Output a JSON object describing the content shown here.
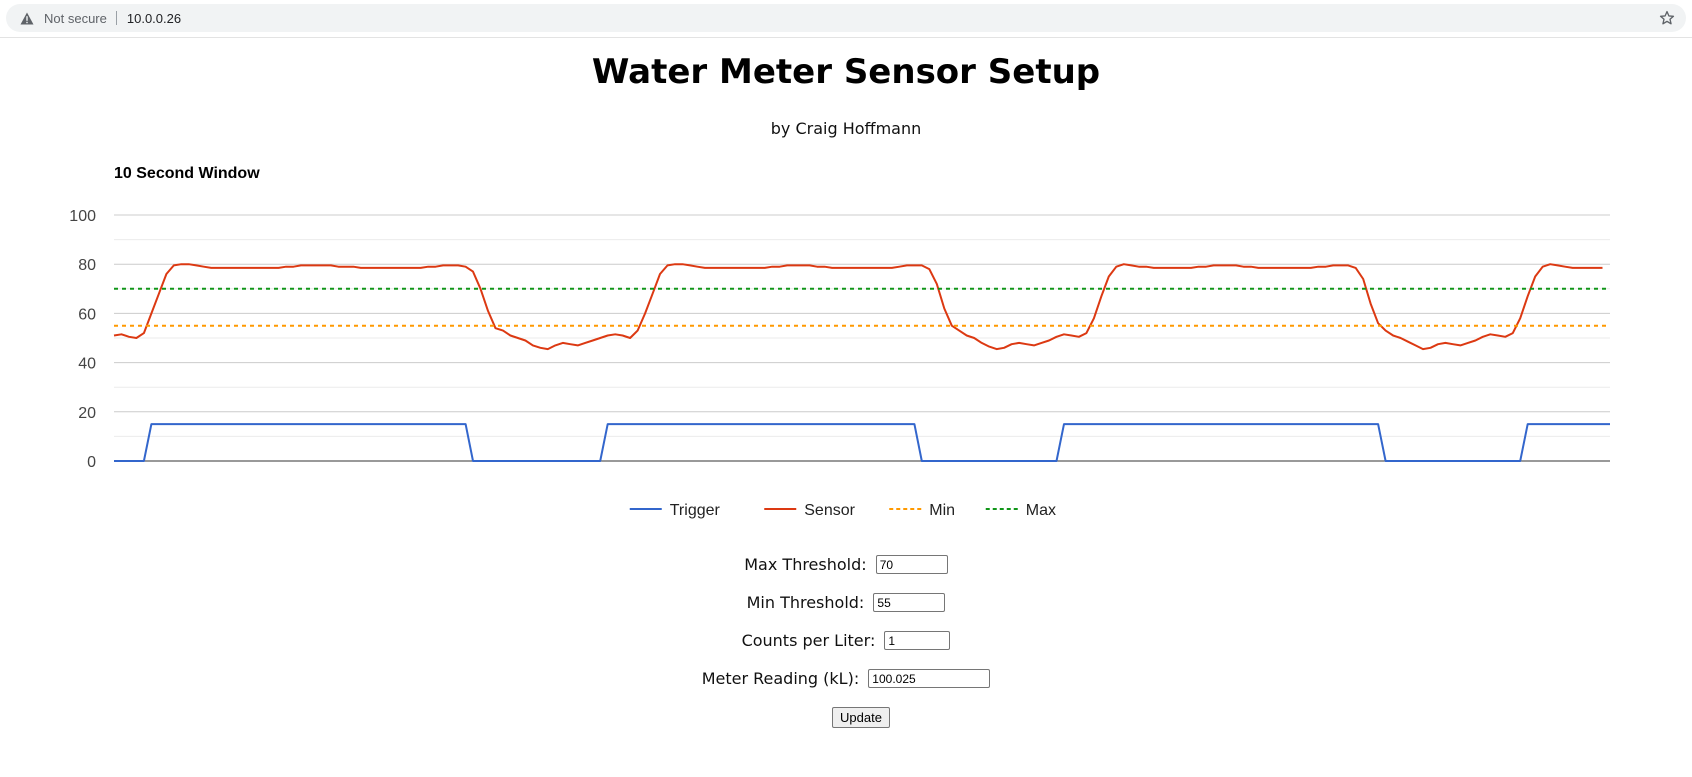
{
  "browser": {
    "security_text": "Not secure",
    "url": "10.0.0.26",
    "icons": [
      "warning-icon",
      "bookmark-star-icon"
    ]
  },
  "page": {
    "title": "Water Meter Sensor Setup",
    "subtitle": "by Craig Hoffmann"
  },
  "form": {
    "max_label": "Max Threshold:",
    "max_value": "70",
    "min_label": "Min Threshold:",
    "min_value": "55",
    "cpl_label": "Counts per Liter:",
    "cpl_value": "1",
    "reading_label": "Meter Reading (kL):",
    "reading_value": "100.025",
    "update_label": "Update"
  },
  "chart_data": {
    "type": "line",
    "title": "10 Second Window",
    "xlabel": "",
    "ylabel": "",
    "ylim": [
      0,
      100
    ],
    "yticks": [
      0,
      20,
      40,
      60,
      80,
      100
    ],
    "x_tick_labels_shown": false,
    "grid": true,
    "legend_position": "bottom",
    "x": [
      0,
      1,
      2,
      3,
      4,
      5,
      6,
      7,
      8,
      9,
      10,
      11,
      12,
      13,
      14,
      15,
      16,
      17,
      18,
      19,
      20,
      21,
      22,
      23,
      24,
      25,
      26,
      27,
      28,
      29,
      30,
      31,
      32,
      33,
      34,
      35,
      36,
      37,
      38,
      39,
      40,
      41,
      42,
      43,
      44,
      45,
      46,
      47,
      48,
      49,
      50,
      51,
      52,
      53,
      54,
      55,
      56,
      57,
      58,
      59,
      60,
      61,
      62,
      63,
      64,
      65,
      66,
      67,
      68,
      69,
      70,
      71,
      72,
      73,
      74,
      75,
      76,
      77,
      78,
      79,
      80,
      81,
      82,
      83,
      84,
      85,
      86,
      87,
      88,
      89,
      90,
      91,
      92,
      93,
      94,
      95,
      96,
      97,
      98,
      99,
      100,
      101,
      102,
      103,
      104,
      105,
      106,
      107,
      108,
      109,
      110,
      111,
      112,
      113,
      114,
      115,
      116,
      117,
      118,
      119,
      120,
      121,
      122,
      123,
      124,
      125,
      126,
      127,
      128,
      129,
      130,
      131,
      132,
      133,
      134,
      135,
      136,
      137,
      138,
      139,
      140,
      141,
      142,
      143,
      144,
      145,
      146,
      147,
      148,
      149,
      150,
      151,
      152,
      153,
      154,
      155,
      156,
      157,
      158,
      159,
      160,
      161,
      162,
      163,
      164,
      165,
      166,
      167,
      168,
      169,
      170,
      171,
      172,
      173,
      174,
      175,
      176,
      177,
      178,
      179,
      180,
      181,
      182,
      183,
      184,
      185,
      186,
      187,
      188,
      189,
      190,
      191,
      192,
      193,
      194,
      195,
      196,
      197,
      198,
      199,
      200
    ],
    "series": [
      {
        "name": "Trigger",
        "color": "#3366cc",
        "style": "solid",
        "values": [
          0,
          0,
          0,
          0,
          0,
          15,
          15,
          15,
          15,
          15,
          15,
          15,
          15,
          15,
          15,
          15,
          15,
          15,
          15,
          15,
          15,
          15,
          15,
          15,
          15,
          15,
          15,
          15,
          15,
          15,
          15,
          15,
          15,
          15,
          15,
          15,
          15,
          15,
          15,
          15,
          15,
          15,
          15,
          15,
          15,
          15,
          15,
          15,
          0,
          0,
          0,
          0,
          0,
          0,
          0,
          0,
          0,
          0,
          0,
          0,
          0,
          0,
          0,
          0,
          0,
          0,
          15,
          15,
          15,
          15,
          15,
          15,
          15,
          15,
          15,
          15,
          15,
          15,
          15,
          15,
          15,
          15,
          15,
          15,
          15,
          15,
          15,
          15,
          15,
          15,
          15,
          15,
          15,
          15,
          15,
          15,
          15,
          15,
          15,
          15,
          15,
          15,
          15,
          15,
          15,
          15,
          15,
          15,
          0,
          0,
          0,
          0,
          0,
          0,
          0,
          0,
          0,
          0,
          0,
          0,
          0,
          0,
          0,
          0,
          0,
          0,
          0,
          15,
          15,
          15,
          15,
          15,
          15,
          15,
          15,
          15,
          15,
          15,
          15,
          15,
          15,
          15,
          15,
          15,
          15,
          15,
          15,
          15,
          15,
          15,
          15,
          15,
          15,
          15,
          15,
          15,
          15,
          15,
          15,
          15,
          15,
          15,
          15,
          15,
          15,
          15,
          15,
          15,
          15,
          15,
          0,
          0,
          0,
          0,
          0,
          0,
          0,
          0,
          0,
          0,
          0,
          0,
          0,
          0,
          0,
          0,
          0,
          0,
          0,
          15,
          15,
          15,
          15,
          15,
          15,
          15,
          15,
          15,
          15,
          15,
          15
        ]
      },
      {
        "name": "Sensor",
        "color": "#dc3912",
        "style": "solid",
        "values": [
          51,
          51.5,
          50.5,
          50,
          52,
          60,
          68,
          76,
          79.5,
          80,
          80,
          79.5,
          79,
          78.5,
          78.5,
          78.5,
          78.5,
          78.5,
          78.5,
          78.5,
          78.5,
          78.5,
          78.5,
          79,
          79,
          79.5,
          79.5,
          79.5,
          79.5,
          79.5,
          79,
          79,
          79,
          78.5,
          78.5,
          78.5,
          78.5,
          78.5,
          78.5,
          78.5,
          78.5,
          78.5,
          79,
          79,
          79.5,
          79.5,
          79.5,
          79,
          77,
          70,
          61,
          54,
          53,
          51,
          50,
          49,
          47,
          46,
          45.5,
          47,
          48,
          47.5,
          47,
          48,
          49,
          50,
          51,
          51.5,
          51,
          50,
          53,
          60,
          68,
          76,
          79.5,
          80,
          80,
          79.5,
          79,
          78.5,
          78.5,
          78.5,
          78.5,
          78.5,
          78.5,
          78.5,
          78.5,
          78.5,
          79,
          79,
          79.5,
          79.5,
          79.5,
          79.5,
          79,
          79,
          78.5,
          78.5,
          78.5,
          78.5,
          78.5,
          78.5,
          78.5,
          78.5,
          78.5,
          79,
          79.5,
          79.5,
          79.5,
          78,
          72,
          62,
          55,
          53,
          51,
          50,
          48,
          46.5,
          45.5,
          46,
          47.5,
          48,
          47.5,
          47,
          48,
          49,
          50.5,
          51.5,
          51,
          50.5,
          52,
          58,
          67,
          75,
          79,
          80,
          79.5,
          79,
          79,
          78.5,
          78.5,
          78.5,
          78.5,
          78.5,
          78.5,
          79,
          79,
          79.5,
          79.5,
          79.5,
          79.5,
          79,
          79,
          78.5,
          78.5,
          78.5,
          78.5,
          78.5,
          78.5,
          78.5,
          78.5,
          79,
          79,
          79.5,
          79.5,
          79.5,
          78.5,
          74,
          64,
          56,
          53,
          51,
          50,
          48.5,
          47,
          45.5,
          46,
          47.5,
          48,
          47.5,
          47,
          48,
          49,
          50.5,
          51.5,
          51,
          50.5,
          52,
          58,
          67,
          75,
          79,
          80,
          79.5,
          79,
          78.5,
          78.5,
          78.5,
          78.5,
          78.5
        ]
      },
      {
        "name": "Min",
        "color": "#ff9900",
        "style": "dashed",
        "constant": 55
      },
      {
        "name": "Max",
        "color": "#109618",
        "style": "dashed",
        "constant": 70
      }
    ]
  }
}
